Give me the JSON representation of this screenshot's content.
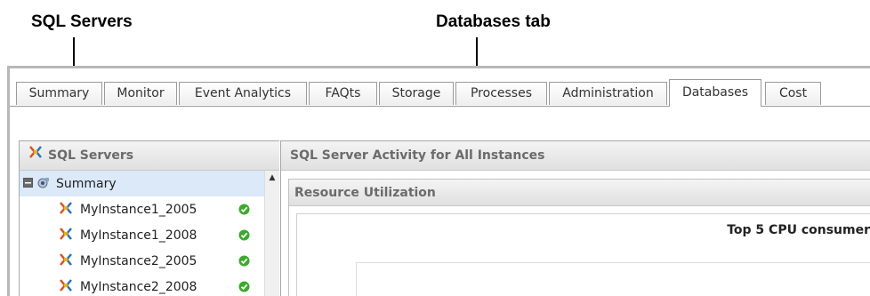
{
  "annotations": {
    "sql_servers": "SQL Servers",
    "databases_tab": "Databases tab"
  },
  "tabs": [
    {
      "label": "Summary",
      "active": false
    },
    {
      "label": "Monitor",
      "active": false
    },
    {
      "label": "Event Analytics",
      "active": false
    },
    {
      "label": "FAQts",
      "active": false
    },
    {
      "label": "Storage",
      "active": false
    },
    {
      "label": "Processes",
      "active": false
    },
    {
      "label": "Administration",
      "active": false
    },
    {
      "label": "Databases",
      "active": true
    },
    {
      "label": "Cost",
      "active": false
    }
  ],
  "left_pane": {
    "title": "SQL Servers",
    "title_icon": "sql-server-icon",
    "tree": {
      "summary": {
        "label": "Summary",
        "expand_state": "collapse-minus",
        "icon": "summary-icon"
      },
      "instances": [
        {
          "label": "MyInstance1_2005",
          "icon": "sql-server-icon",
          "status": "ok-check"
        },
        {
          "label": "MyInstance1_2008",
          "icon": "sql-server-icon",
          "status": "ok-check"
        },
        {
          "label": "MyInstance2_2005",
          "icon": "sql-server-icon",
          "status": "ok-check"
        },
        {
          "label": "MyInstance2_2008",
          "icon": "sql-server-icon",
          "status": "ok-check"
        }
      ]
    }
  },
  "right_pane": {
    "title": "SQL Server Activity for All Instances",
    "panel_title": "Resource Utilization",
    "chart_title": "Top 5 CPU consumer"
  },
  "colors": {
    "selected_row": "#dbe9f9",
    "status_ok": "#3caa2c",
    "header_text": "#6b6b6b"
  }
}
